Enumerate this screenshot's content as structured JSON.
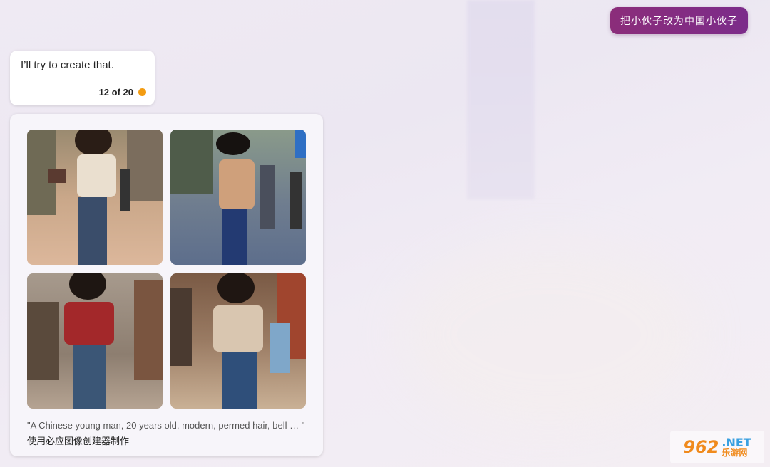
{
  "user_message": {
    "text": "把小伙子改为中国小伙子"
  },
  "bot_message": {
    "text": "I’ll try to create that.",
    "counter": "12 of 20",
    "status_color": "#f39c12"
  },
  "image_result": {
    "images": [
      {
        "alt": "young man with afro in cream patterned shirt and bell-bottom jeans walking on street"
      },
      {
        "alt": "young man in wide black hat and floral shirt with flared jeans on crosswalk"
      },
      {
        "alt": "young man with afro in red jacket and bell-bottom jeans on old street"
      },
      {
        "alt": "young man with curly hair in beige shirt and flared jeans walking under trees"
      }
    ],
    "prompt_caption": "\"A Chinese young man, 20 years old, modern, permed hair, bell … \"",
    "maker_label": "使用必应图像创建器制作"
  },
  "watermark": {
    "number": "962",
    "net": ".NET",
    "cn": "乐游网"
  },
  "colors": {
    "accent": "#8b2d7a",
    "background": "#eee9f3"
  }
}
